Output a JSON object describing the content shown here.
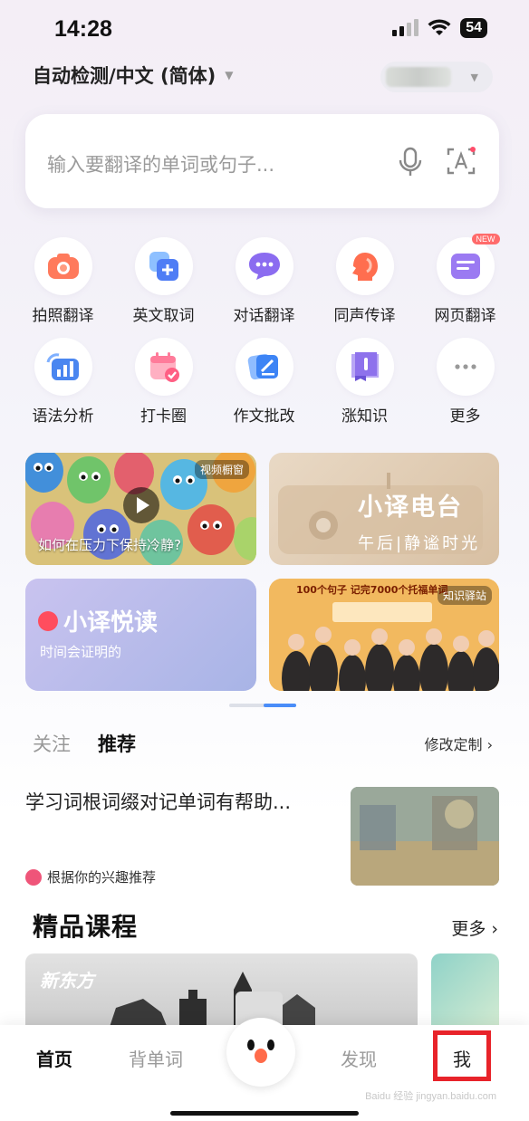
{
  "status_bar": {
    "time": "14:28",
    "battery": "54"
  },
  "language": {
    "source": "自动检测/中文 (简体)"
  },
  "search": {
    "placeholder": "输入要翻译的单词或句子..."
  },
  "tools": [
    {
      "label": "拍照翻译",
      "icon": "camera-icon",
      "color": "#ff7a5c"
    },
    {
      "label": "英文取词",
      "icon": "add-word-icon",
      "color": "#4f7df5"
    },
    {
      "label": "对话翻译",
      "icon": "chat-icon",
      "color": "#8b6cf0"
    },
    {
      "label": "同声传译",
      "icon": "speaker-head-icon",
      "color": "#ff6e4f"
    },
    {
      "label": "网页翻译",
      "icon": "webpage-icon",
      "color": "#9b7af2",
      "badge": "NEW"
    },
    {
      "label": "语法分析",
      "icon": "grammar-chart-icon",
      "color": "#4a86f0"
    },
    {
      "label": "打卡圈",
      "icon": "calendar-check-icon",
      "color": "#ff7b9a"
    },
    {
      "label": "作文批改",
      "icon": "essay-edit-icon",
      "color": "#3d84f5"
    },
    {
      "label": "涨知识",
      "icon": "book-icon",
      "color": "#8e72ec"
    },
    {
      "label": "更多",
      "icon": "more-dots-icon",
      "color": "#999999"
    }
  ],
  "cards": {
    "video": {
      "tag": "视频橱窗",
      "caption": "如何在压力下保持冷静?"
    },
    "radio": {
      "title": "小译电台",
      "subtitle": "午后|静谧时光"
    },
    "read": {
      "title": "小译悦读",
      "subtitle": "时间会证明的"
    },
    "knowledge": {
      "tag": "知识驿站",
      "headline": "100个句子 记完7000个托福单词"
    }
  },
  "feed": {
    "tabs": [
      "关注",
      "推荐"
    ],
    "active_tab": "推荐",
    "customize": "修改定制",
    "article_title": "学习词根词缀对记单词有帮助...",
    "recommend_reason": "根据你的兴趣推荐"
  },
  "courses": {
    "title": "精品课程",
    "more": "更多",
    "course_logo": "新东方"
  },
  "bottom_nav": {
    "items": [
      "首页",
      "背单词",
      "发现",
      "我"
    ],
    "active": "首页"
  },
  "watermark": "Baidu 经验 jingyan.baidu.com"
}
